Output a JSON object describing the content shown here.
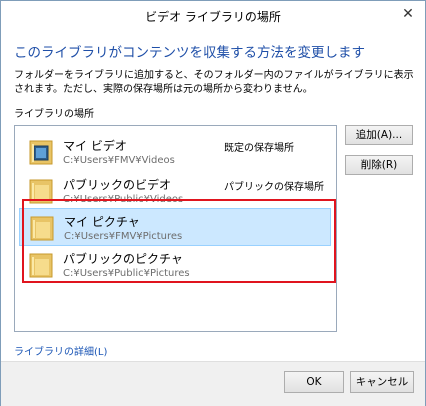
{
  "window": {
    "title": "ビデオ ライブラリの場所",
    "close_glyph": "✕"
  },
  "heading": "このライブラリがコンテンツを収集する方法を変更します",
  "description": "フォルダーをライブラリに追加すると、そのフォルダー内のファイルがライブラリに表示されます。ただし、実際の保存場所は元の場所から変わりません。",
  "section_label": "ライブラリの場所",
  "locations": [
    {
      "name": "マイ ビデオ",
      "path": "C:¥Users¥FMV¥Videos",
      "status": "既定の保存場所",
      "icon": "video-folder-icon",
      "selected": false
    },
    {
      "name": "パブリックのビデオ",
      "path": "C:¥Users¥Public¥Videos",
      "status": "パブリックの保存場所",
      "icon": "folder-icon",
      "selected": false
    },
    {
      "name": "マイ ピクチャ",
      "path": "C:¥Users¥FMV¥Pictures",
      "status": "",
      "icon": "folder-icon",
      "selected": true
    },
    {
      "name": "パブリックのピクチャ",
      "path": "C:¥Users¥Public¥Pictures",
      "status": "",
      "icon": "folder-icon",
      "selected": false
    }
  ],
  "buttons": {
    "add": "追加(A)...",
    "remove": "削除(R)",
    "ok": "OK",
    "cancel": "キャンセル"
  },
  "details_link": "ライブラリの詳細(L)",
  "colors": {
    "heading": "#1f4fa8",
    "selection": "#cce8ff",
    "highlight_box": "#e0141e",
    "link": "#1a55b5"
  }
}
